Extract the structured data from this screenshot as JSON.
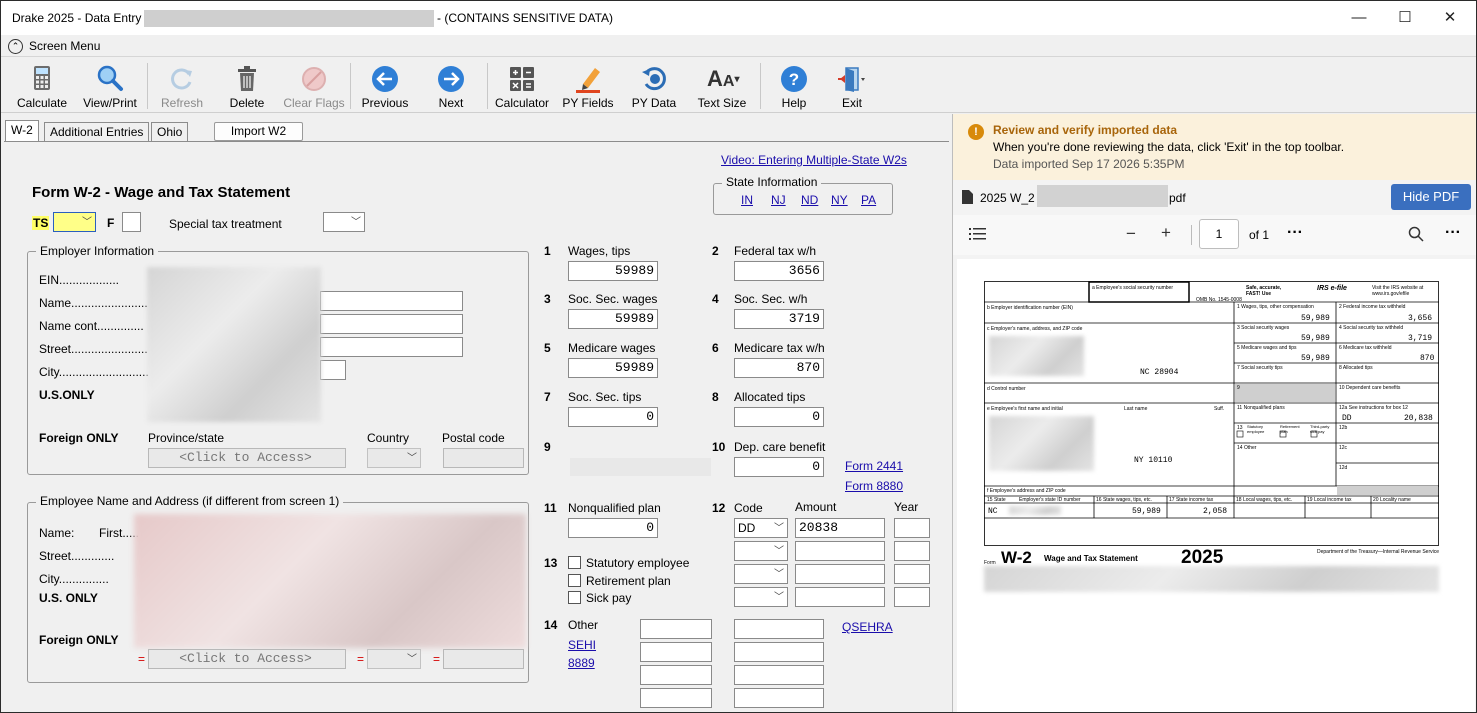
{
  "window": {
    "title": "Drake 2025 - Data Entry",
    "sensitive_note": "- (CONTAINS SENSITIVE DATA)",
    "minimize": "—",
    "maximize": "☐",
    "close": "✕"
  },
  "screen_menu": {
    "label": "Screen Menu"
  },
  "toolbar": {
    "calculate": "Calculate",
    "view_print": "View/Print",
    "refresh": "Refresh",
    "delete": "Delete",
    "clear_flags": "Clear Flags",
    "previous": "Previous",
    "next": "Next",
    "calculator": "Calculator",
    "py_fields": "PY Fields",
    "py_data": "PY Data",
    "text_size": "Text Size",
    "help": "Help",
    "exit": "Exit"
  },
  "tabs": {
    "w2": "W-2",
    "additional": "Additional Entries",
    "ohio": "Ohio",
    "import": "Import W2"
  },
  "form": {
    "video_link": "Video: Entering Multiple-State W2s",
    "title": "Form W-2 - Wage and Tax Statement",
    "ts_label": "TS",
    "f_label": "F",
    "special_tax": "Special tax treatment",
    "state_info": {
      "title": "State Information",
      "states": [
        "IN",
        "NJ",
        "ND",
        "NY",
        "PA"
      ]
    },
    "employer": {
      "title": "Employer Information",
      "ein": "EIN..................",
      "name": "Name.......................",
      "name_cont": "Name cont..............",
      "street": "Street.......................",
      "city": "City...........................",
      "us_only": "U.S.ONLY",
      "foreign_only": "Foreign ONLY",
      "province": "Province/state",
      "country": "Country",
      "postal": "Postal code",
      "click_access": "<Click to Access>"
    },
    "employee": {
      "title": "Employee Name and Address (if different from screen 1)",
      "name": "Name:",
      "first": "First.....",
      "street": "Street.............",
      "city": "City...............",
      "us_only": "U.S. ONLY",
      "foreign_only": "Foreign ONLY",
      "click_access": "<Click to Access>",
      "eq": "="
    },
    "boxes": {
      "b1_num": "1",
      "b1_label": "Wages, tips",
      "b1_value": "59989",
      "b2_num": "2",
      "b2_label": "Federal tax w/h",
      "b2_value": "3656",
      "b3_num": "3",
      "b3_label": "Soc. Sec. wages",
      "b3_value": "59989",
      "b4_num": "4",
      "b4_label": "Soc. Sec. w/h",
      "b4_value": "3719",
      "b5_num": "5",
      "b5_label": "Medicare wages",
      "b5_value": "59989",
      "b6_num": "6",
      "b6_label": "Medicare tax w/h",
      "b6_value": "870",
      "b7_num": "7",
      "b7_label": "Soc. Sec. tips",
      "b7_value": "0",
      "b8_num": "8",
      "b8_label": "Allocated tips",
      "b8_value": "0",
      "b9_num": "9",
      "b10_num": "10",
      "b10_label": "Dep. care benefit",
      "b10_value": "0",
      "form2441": "Form 2441",
      "form8880": "Form 8880",
      "b11_num": "11",
      "b11_label": "Nonqualified  plan",
      "b11_value": "0",
      "b12_num": "12",
      "b12_code": "Code",
      "b12_amount": "Amount",
      "b12_year": "Year",
      "b12_code1": "DD",
      "b12_amount1": "20838",
      "b13_num": "13",
      "b13_statutory": "Statutory employee",
      "b13_retirement": "Retirement plan",
      "b13_sick": "Sick pay",
      "b14_num": "14",
      "b14_label": "Other",
      "b14_sehi": "SEHI",
      "b14_8889": "8889",
      "qsehra": "QSEHRA"
    }
  },
  "pdf_panel": {
    "notice_title": "Review and verify imported data",
    "notice_body": "When you're done reviewing the data, click 'Exit' in the top toolbar.",
    "notice_date": "Data imported Sep 17 2026 5:35PM",
    "file_prefix": "2025 W_2 (",
    "file_suffix": "pdf",
    "hide_pdf": "Hide PDF",
    "page_num": "1",
    "page_of": "of 1",
    "zoom_out": "−",
    "zoom_in": "+",
    "more": "···"
  },
  "w2_image": {
    "box_a": "a  Employee's social security number",
    "omb": "OMB No. 1545-0008",
    "safe": "Safe, accurate, FAST! Use",
    "efile": "IRS e-file",
    "visit": "Visit the IRS website at www.irs.gov/efile",
    "b_label": "b  Employer identification number (EIN)",
    "c_label": "c  Employer's name, address, and ZIP code",
    "d_label": "d  Control number",
    "e_label": "e  Employee's first name and initial",
    "last_name": "Last name",
    "suff": "Suff.",
    "f_label": "f  Employee's address and ZIP code",
    "b1": "1  Wages, tips, other compensation",
    "v1": "59,989",
    "b2": "2  Federal income tax withheld",
    "v2": "3,656",
    "b3": "3  Social security wages",
    "v3": "59,989",
    "b4": "4  Social security tax withheld",
    "v4": "3,719",
    "b5": "5  Medicare wages and tips",
    "v5": "59,989",
    "b6": "6  Medicare tax withheld",
    "v6": "870",
    "b7": "7  Social security tips",
    "b8": "8  Allocated tips",
    "b9": "9",
    "b10": "10  Dependent care benefits",
    "b11": "11  Nonqualified plans",
    "b12a": "12a  See instructions for box 12",
    "b12a_code": "DD",
    "b12a_val": "20,838",
    "b12b": "12b",
    "b12c": "12c",
    "b12d": "12d",
    "b13": "13",
    "b13_statutory": "Statutory employee",
    "b13_retirement": "Retirement plan",
    "b13_sick": "Third-party sick pay",
    "b14": "14  Other",
    "employer_city": "NC    28904",
    "employee_city": "NY    10110",
    "b15": "15  State",
    "b15_id": "Employer's state ID number",
    "b16": "16  State wages, tips, etc.",
    "v16": "59,989",
    "b17": "17  State income tax",
    "v17": "2,058",
    "b18": "18  Local wages, tips, etc.",
    "b19": "19  Local income tax",
    "b20": "20  Locality name",
    "state_code": "NC",
    "form_word": "Form",
    "w2_big": "W-2",
    "wts": "Wage and Tax Statement",
    "year": "2025",
    "dept": "Department of the Treasury—Internal Revenue Service"
  }
}
